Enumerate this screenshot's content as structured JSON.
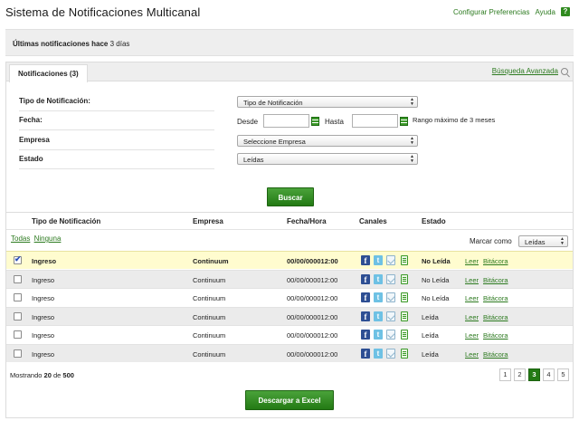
{
  "header": {
    "app_title": "Sistema de Notificaciones Multicanal",
    "preferences_link": "Configurar Preferencias",
    "help_link": "Ayuda",
    "help_badge": "?"
  },
  "notice": {
    "prefix": "Últimas notificaciones hace",
    "value": "3 días"
  },
  "tabs": {
    "active_tab": "Notificaciones (3)",
    "advanced_search": "Búsqueda Avanzada"
  },
  "form": {
    "type_label": "Tipo de Notificación:",
    "type_value": "Tipo de Notificación",
    "date_label": "Fecha:",
    "from_label": "Desde",
    "from_value": "",
    "to_label": "Hasta",
    "to_value": "",
    "range_note": "Rango máximo de 3 meses",
    "company_label": "Empresa",
    "company_value": "Seleccione Empresa",
    "status_label": "Estado",
    "status_value": "Leídas",
    "search_button": "Buscar"
  },
  "table": {
    "headers": {
      "type": "Tipo de Notificación",
      "company": "Empresa",
      "datetime": "Fecha/Hora",
      "channels": "Canales",
      "status": "Estado"
    },
    "select_all": "Todas",
    "select_none": "Ninguna",
    "mark_as_label": "Marcar como",
    "mark_as_value": "Leídas",
    "read_action": "Leer",
    "log_action": "Bitácora",
    "rows": [
      {
        "checked": true,
        "type": "Ingreso",
        "company": "Continuum",
        "datetime": "00/00/000012:00",
        "status": "No Leída",
        "unread": true
      },
      {
        "checked": false,
        "type": "Ingreso",
        "company": "Continuum",
        "datetime": "00/00/000012:00",
        "status": "No Leída",
        "unread": false
      },
      {
        "checked": false,
        "type": "Ingreso",
        "company": "Continuum",
        "datetime": "00/00/000012:00",
        "status": "No Leída",
        "unread": false
      },
      {
        "checked": false,
        "type": "Ingreso",
        "company": "Continuum",
        "datetime": "00/00/000012:00",
        "status": "Leída",
        "unread": false
      },
      {
        "checked": false,
        "type": "Ingreso",
        "company": "Continuum",
        "datetime": "00/00/000012:00",
        "status": "Leída",
        "unread": false
      },
      {
        "checked": false,
        "type": "Ingreso",
        "company": "Continuum",
        "datetime": "00/00/000012:00",
        "status": "Leída",
        "unread": false
      }
    ],
    "channel_icons": [
      "facebook-icon",
      "twitter-icon",
      "email-icon",
      "sms-icon"
    ]
  },
  "footer": {
    "showing_prefix": "Mostrando",
    "showing_count": "20",
    "showing_of": "de",
    "showing_total": "500",
    "pages": [
      "1",
      "2",
      "3",
      "4",
      "5"
    ],
    "current_page": "3",
    "export_button": "Descargar a Excel"
  },
  "colors": {
    "accent": "#2c7a1f",
    "selected_row": "#fffccf",
    "alt_row": "#ebebeb",
    "button": "#237a14"
  }
}
